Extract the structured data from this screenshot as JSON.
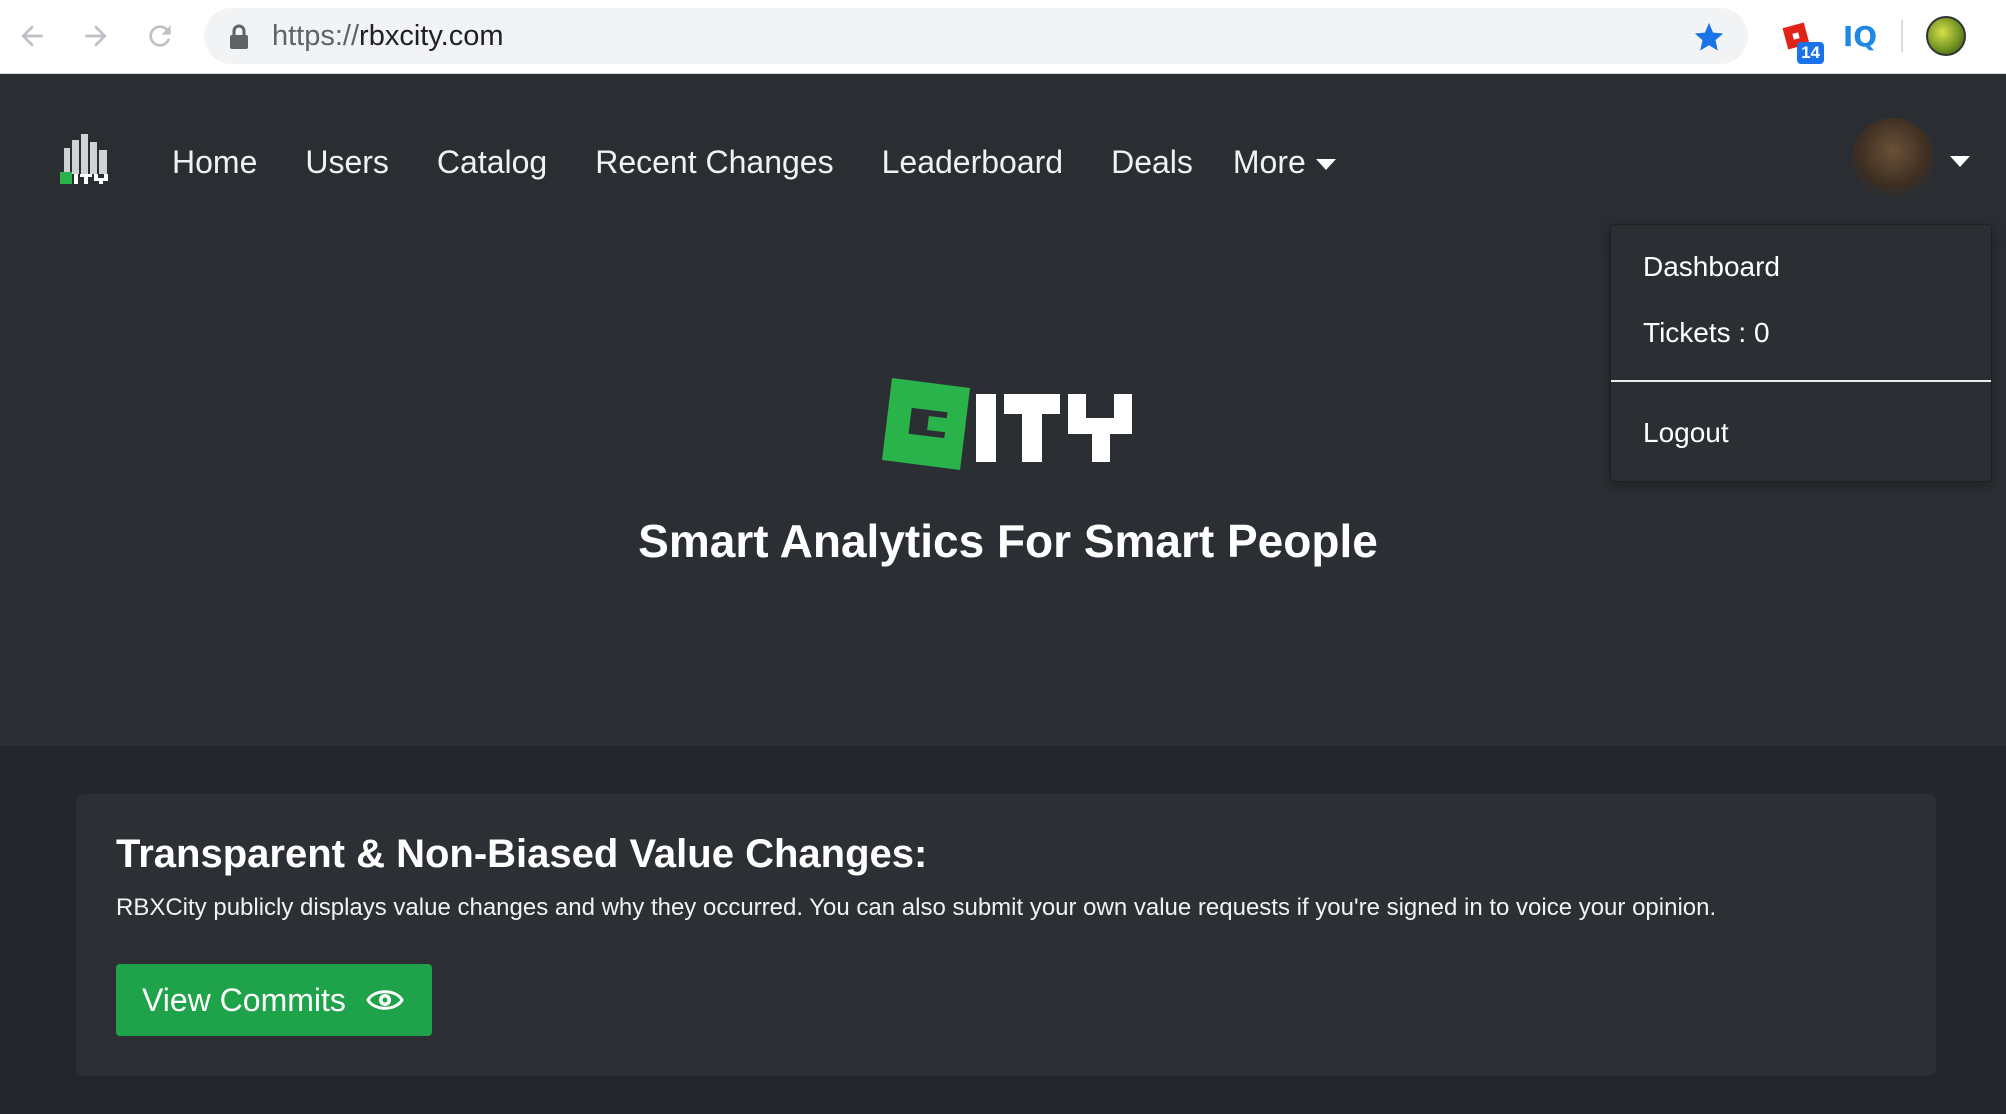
{
  "browser": {
    "url_scheme": "https://",
    "url_host": "rbxcity.com",
    "extension_badge": "14",
    "extension_iq": "IQ",
    "accent_color": "#1a73e8"
  },
  "navbar": {
    "links": [
      "Home",
      "Users",
      "Catalog",
      "Recent Changes",
      "Leaderboard",
      "Deals"
    ],
    "more_label": "More"
  },
  "dropdown": {
    "items": [
      "Dashboard",
      "Tickets : 0"
    ],
    "logout": "Logout"
  },
  "hero": {
    "logo_text": "CITY",
    "tagline": "Smart Analytics For Smart People"
  },
  "card": {
    "title": "Transparent & Non-Biased Value Changes:",
    "text": "RBXCity publicly displays value changes and why they occurred. You can also submit your own value requests if you're signed in to voice your opinion.",
    "button_label": "View Commits",
    "button_color": "#1fa34a"
  },
  "icons": [
    "back-arrow-icon",
    "forward-arrow-icon",
    "reload-icon",
    "lock-icon",
    "bookmark-star-icon",
    "roblox-extension-icon",
    "iq-extension-icon",
    "profile-avatar-icon",
    "city-logo-icon",
    "eye-icon",
    "caret-down-icon"
  ]
}
